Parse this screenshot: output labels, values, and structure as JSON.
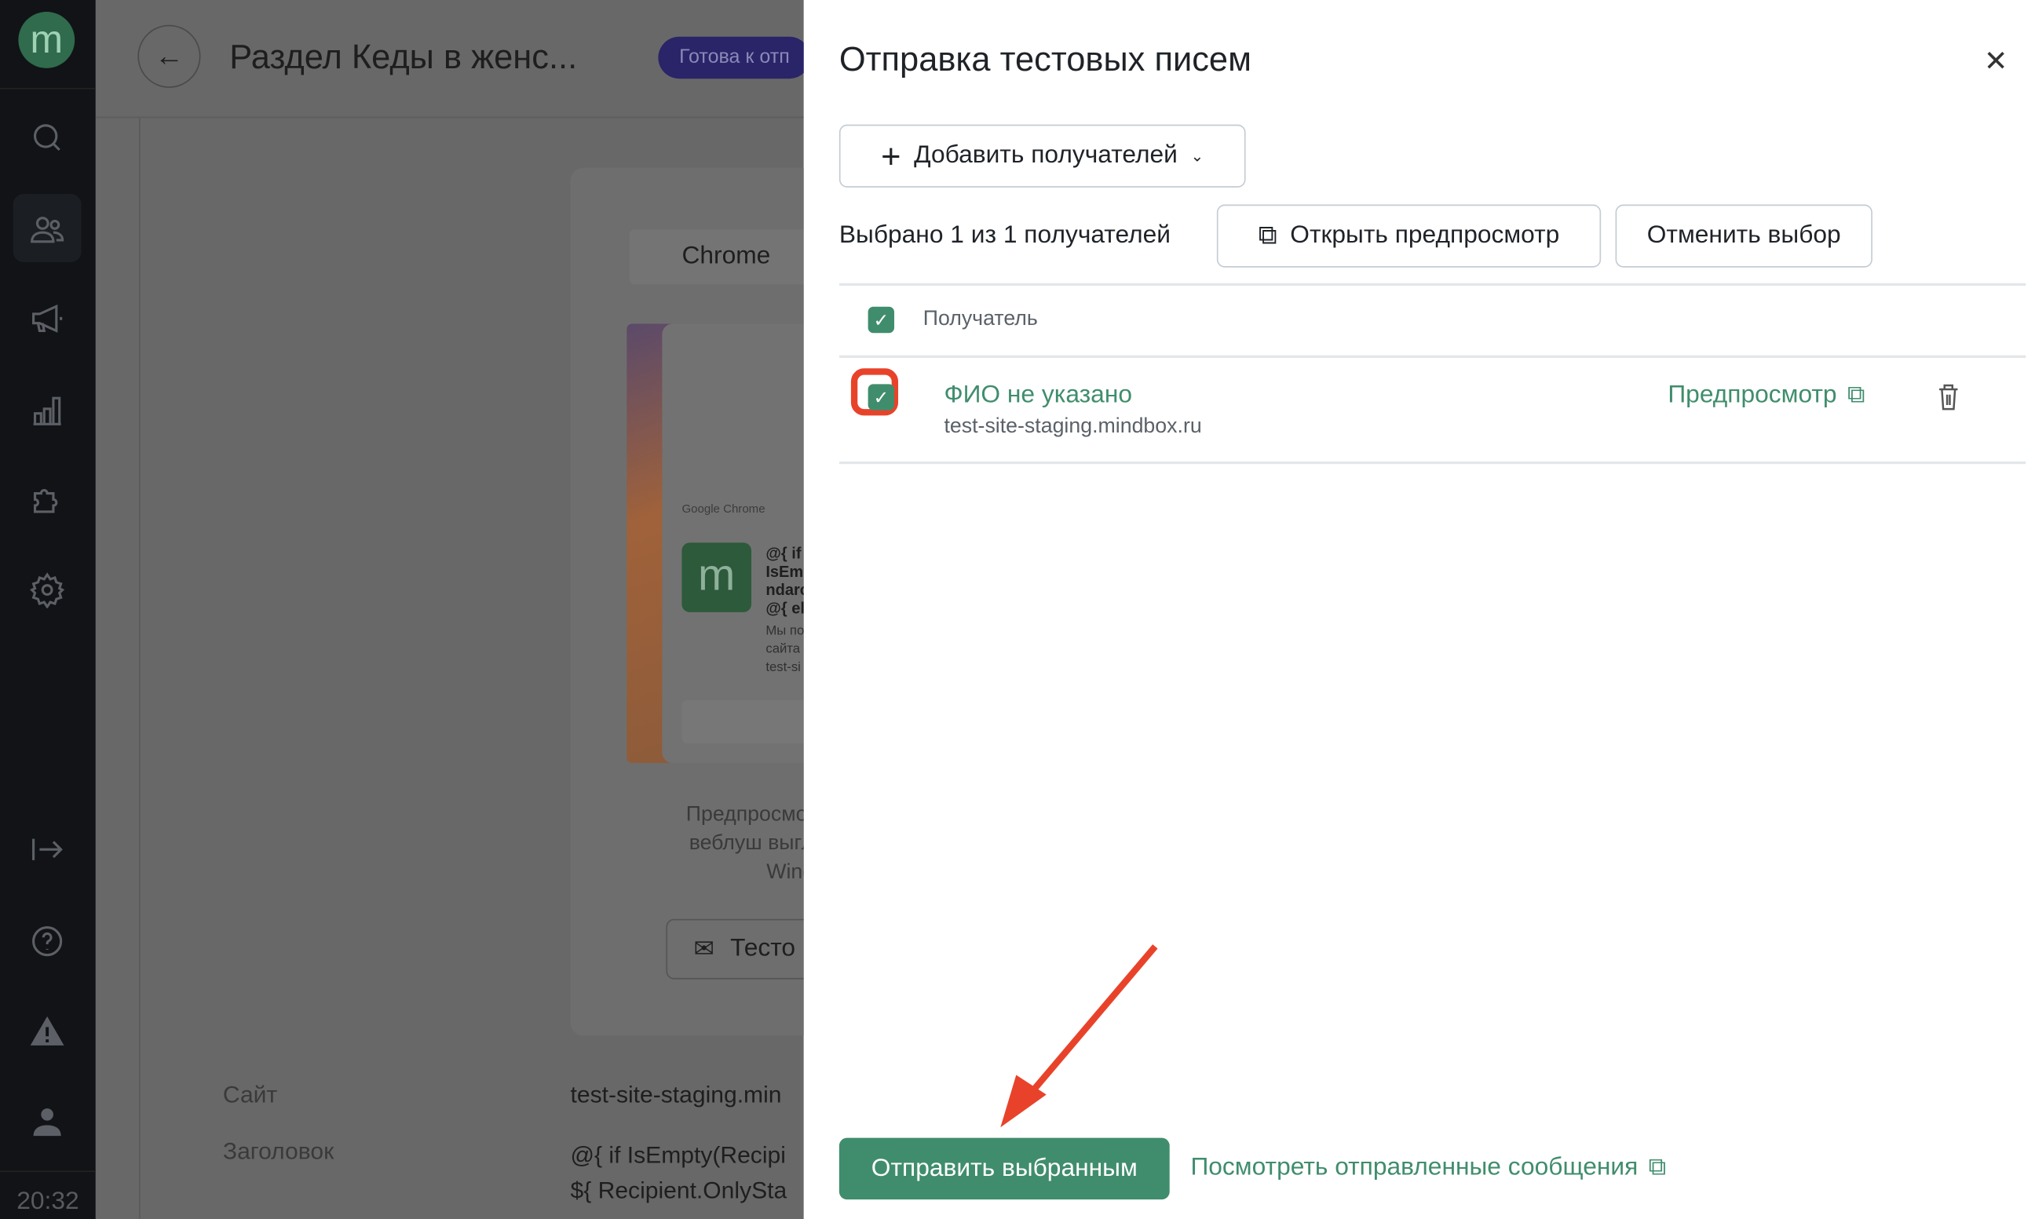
{
  "sidebar": {
    "logo": "m",
    "time": "20:32",
    "icons": [
      "search-icon",
      "users-icon",
      "megaphone-icon",
      "chart-icon",
      "puzzle-icon",
      "gear-icon",
      "logout-icon",
      "help-icon",
      "warning-icon",
      "user-icon"
    ],
    "active": "users-icon"
  },
  "background": {
    "title": "Раздел Кеды в женс...",
    "status_badge": "Готова к отп",
    "tab": "Chrome",
    "notification": {
      "source": "Google Chrome",
      "lines": [
        "@{ if",
        "IsEmp",
        "ndarc",
        "@{ el"
      ],
      "body": [
        "Мы по",
        "сайта",
        "test-si"
      ]
    },
    "preview_caption": [
      "Предпросмот",
      "веблуш выгл",
      "Window"
    ],
    "test_button": "Тесто",
    "fields": [
      {
        "label": "Сайт",
        "value": [
          "test-site-staging.min"
        ]
      },
      {
        "label": "Заголовок",
        "value": [
          "@{ if IsEmpty(Recipi",
          "${ Recipient.OnlySta"
        ]
      }
    ]
  },
  "panel": {
    "title": "Отправка тестовых писем",
    "add_recipients": "Добавить получателей",
    "selected_text": "Выбрано 1 из 1 получателей",
    "open_preview": "Открыть предпросмотр",
    "cancel_selection": "Отменить выбор",
    "column_header": "Получатель",
    "recipients": [
      {
        "name": "ФИО не указано",
        "site": "test-site-staging.mindbox.ru",
        "preview_link": "Предпросмотр",
        "checked": true
      }
    ],
    "send_button": "Отправить выбранным",
    "sent_link": "Посмотреть отправленные сообщения"
  },
  "colors": {
    "accent": "#408d6d",
    "annotation": "#e8432a",
    "badge": "#2a2468"
  }
}
